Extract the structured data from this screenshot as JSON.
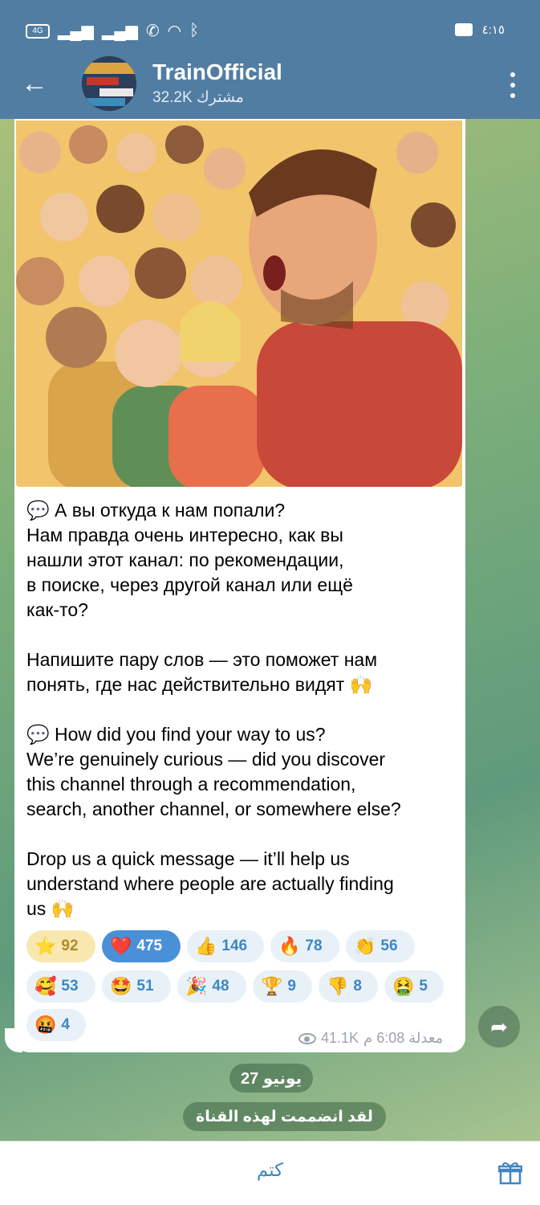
{
  "status_bar": {
    "left_badge": "4G",
    "time": "٤:١٥"
  },
  "header": {
    "title": "TrainOfficial",
    "subscribers": "32.2K مشترك"
  },
  "message": {
    "ru_question": "💬 А вы откуда к нам попали?\nНам правда очень интересно, как вы\nнашли этот канал: по рекомендации,\nв поиске, через другой канал или ещё\nкак-то?\n\nНапишите пару слов — это поможет нам\nпонять, где нас действительно видят 🙌\n\n💬 How did you find your way to us?\nWe’re genuinely curious — did you discover\nthis channel through a recommendation,\nsearch, another channel, or somewhere else?\n\nDrop us a quick message — it’ll help us\nunderstand where people are actually finding\nus 🙌",
    "views": "41.1K",
    "time_label": "معدلة 6:08 م"
  },
  "reactions": [
    {
      "emoji": "⭐",
      "count": "92"
    },
    {
      "emoji": "❤️",
      "count": "475"
    },
    {
      "emoji": "👍",
      "count": "146"
    },
    {
      "emoji": "🔥",
      "count": "78"
    },
    {
      "emoji": "👏",
      "count": "56"
    },
    {
      "emoji": "🥰",
      "count": "53"
    },
    {
      "emoji": "🤩",
      "count": "51"
    },
    {
      "emoji": "🎉",
      "count": "48"
    },
    {
      "emoji": "🏆",
      "count": "9"
    },
    {
      "emoji": "👎",
      "count": "8"
    },
    {
      "emoji": "🤮",
      "count": "5"
    },
    {
      "emoji": "🤬",
      "count": "4"
    }
  ],
  "date_separator": "27 يونيو",
  "service_message": "لقد انضممت لهذه القناة",
  "bottom_bar": {
    "mute_label": "كتم"
  },
  "icons": {
    "back": "arrow-left-icon",
    "menu": "more-vertical-icon",
    "share": "share-icon",
    "views": "eye-icon",
    "gift": "gift-icon"
  }
}
